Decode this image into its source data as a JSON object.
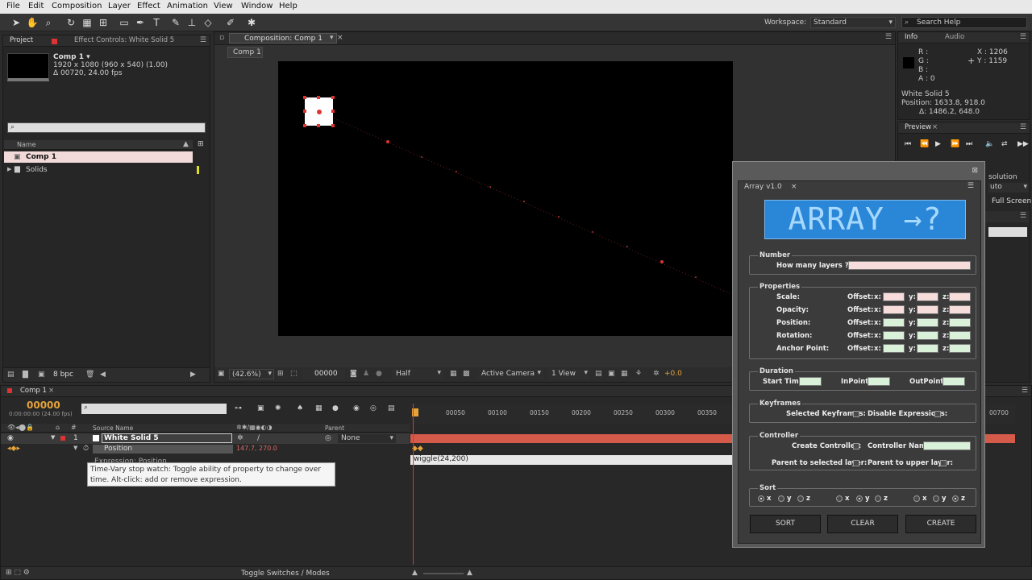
{
  "menu": [
    "File",
    "Edit",
    "Composition",
    "Layer",
    "Effect",
    "Animation",
    "View",
    "Window",
    "Help"
  ],
  "toolbar": {
    "workspace_label": "Workspace:",
    "workspace_value": "Standard",
    "search_placeholder": "Search Help"
  },
  "project": {
    "tab": "Project",
    "tab2": "Effect Controls: White Solid 5",
    "comp_name": "Comp 1 ▾",
    "comp_info1": "1920 x 1080  (960 x 540) (1.00)",
    "comp_info2": "Δ 00720, 24.00 fps",
    "col_name": "Name",
    "items": [
      "Comp 1",
      "Solids"
    ],
    "bpc": "8 bpc"
  },
  "composition": {
    "tab": "Composition: Comp 1",
    "subtab": "Comp 1",
    "zoom": "(42.6%)",
    "timecode": "00000",
    "res": "Half",
    "camera": "Active Camera",
    "view": "1 View",
    "exposure": "+0.0"
  },
  "info": {
    "tab": "Info",
    "tab2": "Audio",
    "r": "R :",
    "g": "G :",
    "b": "B :",
    "a": "A : 0",
    "x": "X : 1206",
    "y": "Y : 1159",
    "layer": "White Solid 5",
    "position": "Position: 1633.8, 918.0",
    "delta": "Δ: 1486.2, 648.0"
  },
  "preview": {
    "tab": "Preview",
    "solution": "solution",
    "full_screen": "Full Screen",
    "auto": "uto"
  },
  "timeline": {
    "tab": "Comp 1",
    "timecode": "00000",
    "fps": "0:00:00:00 (24.00 fps)",
    "col_source": "Source Name",
    "col_parent": "Parent",
    "layer_num": "1",
    "layer_name": "White Solid 5",
    "parent": "None",
    "prop": "Position",
    "prop_val": "147.7, 270.0",
    "expr_label": "Expression: Position",
    "expr": "wiggle(24,200)",
    "toggle": "Toggle Switches / Modes",
    "ruler": [
      "00050",
      "00100",
      "00150",
      "00200",
      "00250",
      "00300",
      "00350",
      "00700"
    ],
    "tooltip": "Time-Vary stop watch: Toggle ability of property to change over time. Alt-click: add or remove expression."
  },
  "array": {
    "title": "Array v1.0",
    "logo": "ARRAY →?",
    "number": {
      "title": "Number",
      "label": "How many layers ?"
    },
    "properties": {
      "title": "Properties",
      "rows": [
        "Scale:",
        "Opacity:",
        "Position:",
        "Rotation:",
        "Anchor Point:"
      ],
      "offset": "Offset:",
      "x": "x:",
      "y": "y:",
      "z": "z:"
    },
    "duration": {
      "title": "Duration",
      "start": "Start Time:",
      "inpoint": "InPoint:",
      "outpoint": "OutPoint:"
    },
    "keyframes": {
      "title": "Keyframes",
      "selected": "Selected Keyframes:",
      "disable": "Disable Expressions:"
    },
    "controller": {
      "title": "Controller",
      "create": "Create Controller:",
      "name": "Controller Name:",
      "parent_sel": "Parent to selected layer:",
      "parent_up": "Parent to upper layer:"
    },
    "sort": {
      "title": "Sort",
      "x": "x",
      "y": "y",
      "z": "z"
    },
    "buttons": {
      "sort": "SORT",
      "clear": "CLEAR",
      "create": "CREATE"
    }
  }
}
